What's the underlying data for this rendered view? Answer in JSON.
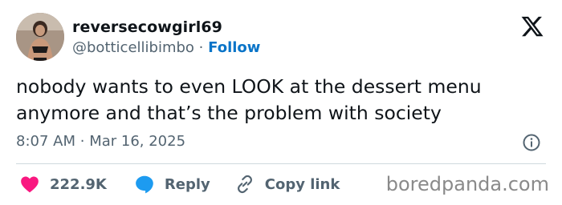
{
  "author": {
    "display_name": "reversecowgirl69",
    "handle": "@botticellibimbo",
    "separator": "·",
    "follow_label": "Follow"
  },
  "tweet": {
    "text": "nobody wants to even LOOK at the dessert menu anymore and that’s the problem with society",
    "time": "8:07 AM",
    "separator": "·",
    "date": "Mar 16, 2025"
  },
  "actions": {
    "like_count": "222.9K",
    "reply_label": "Reply",
    "copy_link_label": "Copy link"
  },
  "icons": {
    "brand": "x-logo-icon",
    "info": "info-icon",
    "like": "heart-icon",
    "reply": "speech-bubble-icon",
    "copy_link": "link-icon"
  },
  "colors": {
    "like": "#f91880",
    "reply": "#1d9bf0",
    "follow": "#0a74c8",
    "secondary_text": "#536471"
  },
  "watermark": "boredpanda.com"
}
